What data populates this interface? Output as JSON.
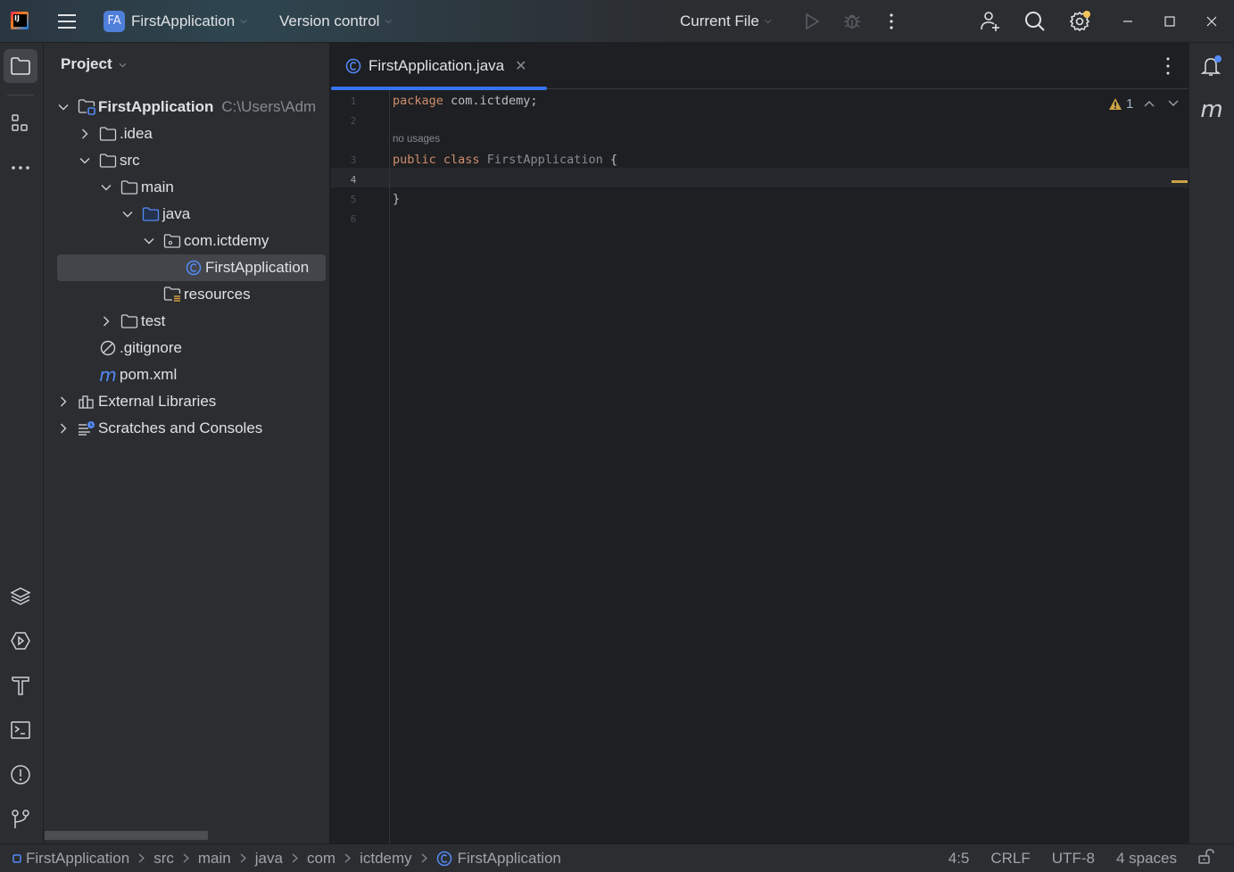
{
  "titlebar": {
    "project_badge": "FA",
    "project_name": "FirstApplication",
    "vcs_label": "Version control",
    "run_config": "Current File",
    "icons": [
      "app-logo",
      "main-menu-icon",
      "run-icon",
      "debug-icon",
      "more-vertical-icon",
      "add-user-icon",
      "search-icon",
      "settings-icon",
      "minimize-icon",
      "maximize-icon",
      "close-icon"
    ]
  },
  "left_stripe": {
    "top": [
      {
        "name": "project",
        "icon": "folder-icon",
        "active": true
      },
      {
        "name": "structure",
        "icon": "structure-icon",
        "active": false
      },
      {
        "name": "more",
        "icon": "more-horizontal-icon",
        "active": false
      }
    ],
    "bottom": [
      {
        "name": "services",
        "icon": "layers-icon"
      },
      {
        "name": "run",
        "icon": "run-hex-icon"
      },
      {
        "name": "build",
        "icon": "hammer-icon"
      },
      {
        "name": "terminal",
        "icon": "terminal-icon"
      },
      {
        "name": "problems",
        "icon": "problems-icon"
      },
      {
        "name": "git",
        "icon": "git-branch-icon"
      }
    ]
  },
  "project_panel": {
    "title": "Project",
    "tree": [
      {
        "label": "FirstApplication",
        "path": "C:\\Users\\Adm",
        "depth": 0,
        "expanded": true,
        "icon": "module-folder",
        "bold": true
      },
      {
        "label": ".idea",
        "depth": 1,
        "expanded": false,
        "icon": "folder"
      },
      {
        "label": "src",
        "depth": 1,
        "expanded": true,
        "icon": "folder"
      },
      {
        "label": "main",
        "depth": 2,
        "expanded": true,
        "icon": "folder"
      },
      {
        "label": "java",
        "depth": 3,
        "expanded": true,
        "icon": "source-folder"
      },
      {
        "label": "com.ictdemy",
        "depth": 4,
        "expanded": true,
        "icon": "package"
      },
      {
        "label": "FirstApplication",
        "depth": 5,
        "icon": "class",
        "selected": true
      },
      {
        "label": "resources",
        "depth": 4,
        "icon": "resources-folder"
      },
      {
        "label": "test",
        "depth": 2,
        "expanded": false,
        "icon": "folder"
      },
      {
        "label": ".gitignore",
        "depth": 1,
        "icon": "ignore"
      },
      {
        "label": "pom.xml",
        "depth": 1,
        "icon": "maven"
      },
      {
        "label": "External Libraries",
        "depth": 0,
        "expanded": false,
        "icon": "library"
      },
      {
        "label": "Scratches and Consoles",
        "depth": 0,
        "expanded": false,
        "icon": "scratches"
      }
    ]
  },
  "editor": {
    "tab": {
      "label": "FirstApplication.java",
      "active": true
    },
    "lines": [
      {
        "no": "1",
        "tokens": [
          {
            "t": "package ",
            "k": "kw"
          },
          {
            "t": "com.ictdemy;",
            "k": "plain"
          }
        ]
      },
      {
        "no": "2",
        "tokens": []
      },
      {
        "no": "3",
        "hint": "no usages",
        "tokens": [
          {
            "t": "public ",
            "k": "kw"
          },
          {
            "t": "class ",
            "k": "kw"
          },
          {
            "t": "FirstApplication ",
            "k": "cls"
          },
          {
            "t": "{",
            "k": "plain"
          }
        ]
      },
      {
        "no": "4",
        "current": true,
        "tokens": []
      },
      {
        "no": "5",
        "tokens": [
          {
            "t": "}",
            "k": "plain"
          }
        ]
      },
      {
        "no": "6",
        "tokens": []
      }
    ],
    "inspection": {
      "warnings": "1"
    }
  },
  "statusbar": {
    "breadcrumbs": [
      "FirstApplication",
      "src",
      "main",
      "java",
      "com",
      "ictdemy",
      "FirstApplication"
    ],
    "caret": "4:5",
    "line_sep": "CRLF",
    "encoding": "UTF-8",
    "indent": "4 spaces"
  },
  "colors": {
    "accent": "#3574f0",
    "keyword": "#cf8e6d",
    "warning": "#c9a244",
    "badge": "#4e7fd9"
  }
}
